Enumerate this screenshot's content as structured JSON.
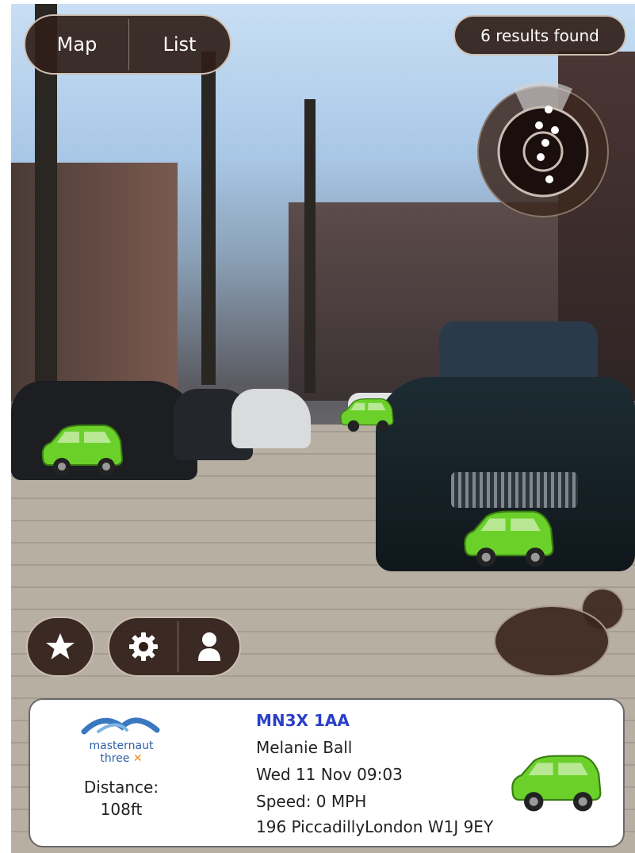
{
  "view_toggle": {
    "map_label": "Map",
    "list_label": "List"
  },
  "results": {
    "label": "6 results found"
  },
  "radar": {
    "icon": "radar-icon"
  },
  "toolbar": {
    "favorite_icon": "star-icon",
    "settings_icon": "gear-icon",
    "profile_icon": "person-icon"
  },
  "info_card": {
    "brand_line1": "masternaut",
    "brand_line2": "three",
    "distance_label": "Distance:",
    "distance_value": "108ft",
    "registration": "MN3X 1AA",
    "driver": "Melanie Ball",
    "timestamp": "Wed 11 Nov 09:03",
    "speed": "Speed: 0 MPH",
    "address": "196 PiccadillyLondon W1J 9EY"
  },
  "colors": {
    "accent_blue": "#2a3fc8",
    "vehicle_green": "#6bd12a",
    "overlay_brown": "#301e18"
  }
}
